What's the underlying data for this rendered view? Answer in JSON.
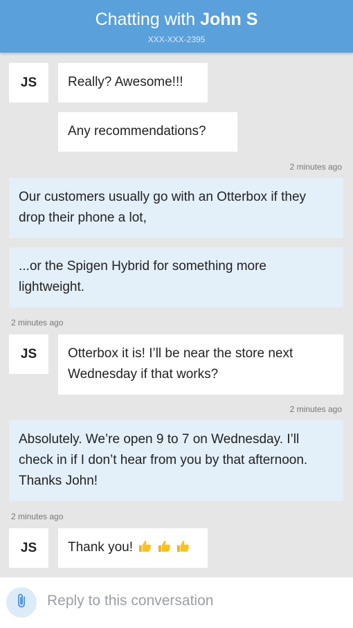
{
  "header": {
    "title_prefix": "Chatting with ",
    "contact_name": "John S",
    "phone": "XXX-XXX-2395"
  },
  "messages": [
    {
      "from": "customer",
      "initials": "JS",
      "text": "Really? Awesome!!!"
    },
    {
      "from": "customer",
      "initials": "",
      "text": "Any recommendations?"
    },
    {
      "from": "agent",
      "timestamp": "2 minutes ago",
      "text": "Our customers usually go with an Otterbox if they drop their phone a lot,"
    },
    {
      "from": "agent",
      "text": "...or the Spigen Hybrid for something more lightweight."
    },
    {
      "from": "customer",
      "timestamp": "2 minutes ago",
      "initials": "JS",
      "text": "Otterbox it is! I’ll be near the store next Wednesday if that works?"
    },
    {
      "from": "agent",
      "timestamp": "2 minutes ago",
      "text": "Absolutely. We’re open 9 to 7 on Wednesday. I’ll check in if I don’t hear from you by that afternoon. Thanks John!"
    },
    {
      "from": "customer",
      "timestamp": "2 minutes ago",
      "initials": "JS",
      "text": "Thank you!",
      "icons": [
        "thumbs-up-icon",
        "thumbs-up-icon",
        "thumbs-up-icon"
      ]
    }
  ],
  "composer": {
    "icon": "paperclip-icon",
    "placeholder": "Reply to this conversation"
  },
  "colors": {
    "header": "#5aa0db",
    "background": "#e6e6e6",
    "agent_bubble": "#e3eff9",
    "customer_bubble": "#ffffff",
    "attach_button": "#dcebf8"
  }
}
